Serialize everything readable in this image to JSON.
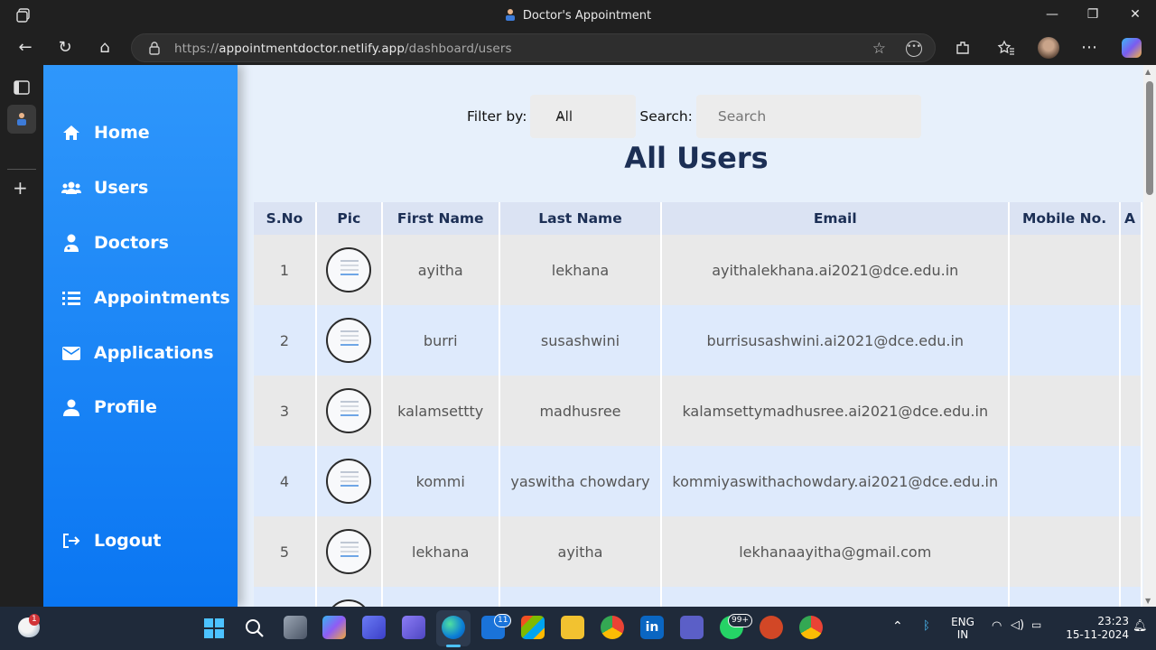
{
  "window": {
    "title": "Doctor's Appointment",
    "minimize_glyph": "—",
    "restore_glyph": "❐",
    "close_glyph": "✕"
  },
  "browser": {
    "url_prefix": "https://",
    "url_host": "appointmentdoctor.netlify.app",
    "url_path": "/dashboard/users",
    "back_glyph": "←",
    "refresh_glyph": "↻",
    "home_glyph": "⌂",
    "more_glyph": "⋯"
  },
  "sidebar": {
    "items": [
      {
        "label": "Home",
        "icon": "home-icon"
      },
      {
        "label": "Users",
        "icon": "users-icon"
      },
      {
        "label": "Doctors",
        "icon": "doctor-icon"
      },
      {
        "label": "Appointments",
        "icon": "list-icon"
      },
      {
        "label": "Applications",
        "icon": "envelope-icon"
      },
      {
        "label": "Profile",
        "icon": "user-icon"
      }
    ],
    "logout": {
      "label": "Logout",
      "icon": "logout-icon"
    }
  },
  "filter": {
    "label": "Filter by:",
    "selected": "All",
    "search_label": "Search:",
    "search_placeholder": "Search"
  },
  "heading": "All Users",
  "table": {
    "columns": [
      "S.No",
      "Pic",
      "First Name",
      "Last Name",
      "Email",
      "Mobile No.",
      "A"
    ],
    "rows": [
      {
        "sno": "1",
        "first": "ayitha",
        "last": "lekhana",
        "email": "ayithalekhana.ai2021@dce.edu.in",
        "mobile": ""
      },
      {
        "sno": "2",
        "first": "burri",
        "last": "susashwini",
        "email": "burrisusashwini.ai2021@dce.edu.in",
        "mobile": ""
      },
      {
        "sno": "3",
        "first": "kalamsettty",
        "last": "madhusree",
        "email": "kalamsettymadhusree.ai2021@dce.edu.in",
        "mobile": ""
      },
      {
        "sno": "4",
        "first": "kommi",
        "last": "yaswitha chowdary",
        "email": "kommiyaswithachowdary.ai2021@dce.edu.in",
        "mobile": ""
      },
      {
        "sno": "5",
        "first": "lekhana",
        "last": "ayitha",
        "email": "lekhanaayitha@gmail.com",
        "mobile": ""
      }
    ]
  },
  "taskbar": {
    "weather_badge": "1",
    "mail_badge": "11",
    "whatsapp_badge": "99+",
    "lang": "ENG",
    "region": "IN",
    "time": "23:23",
    "date": "15-11-2024"
  },
  "colors": {
    "sidebar_top": "#2f97fb",
    "sidebar_bottom": "#0a76f2",
    "heading": "#1c2f55",
    "page_bg": "#e7f0fb"
  }
}
